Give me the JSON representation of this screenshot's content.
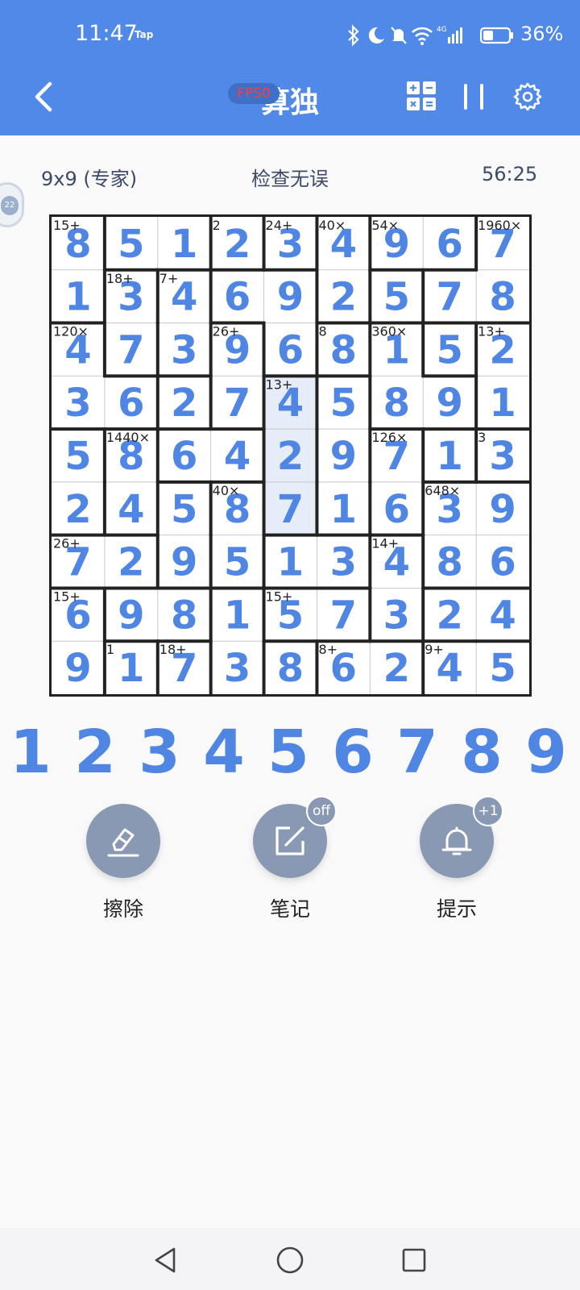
{
  "status_bar": {
    "time": "11:47",
    "tap_label": "Tap",
    "battery_pct": "36%"
  },
  "header": {
    "title": "算独",
    "fps": "FPS0"
  },
  "info": {
    "size_label": "9x9 (专家)",
    "status": "检查无误",
    "timer": "56:25",
    "bubble_label": "22"
  },
  "grid": {
    "values": [
      [
        8,
        5,
        1,
        2,
        3,
        4,
        9,
        6,
        7
      ],
      [
        1,
        3,
        4,
        6,
        9,
        2,
        5,
        7,
        8
      ],
      [
        4,
        7,
        3,
        9,
        6,
        8,
        1,
        5,
        2
      ],
      [
        3,
        6,
        2,
        7,
        4,
        5,
        8,
        9,
        1
      ],
      [
        5,
        8,
        6,
        4,
        2,
        9,
        7,
        1,
        3
      ],
      [
        2,
        4,
        5,
        8,
        7,
        1,
        6,
        3,
        9
      ],
      [
        7,
        2,
        9,
        5,
        1,
        3,
        4,
        8,
        6
      ],
      [
        6,
        9,
        8,
        1,
        5,
        7,
        3,
        2,
        4
      ],
      [
        9,
        1,
        7,
        3,
        8,
        6,
        2,
        4,
        5
      ]
    ],
    "cages": [
      {
        "clue": "15+",
        "cells": [
          [
            0,
            0
          ],
          [
            1,
            0
          ]
        ]
      },
      {
        "clue": "",
        "cells": [
          [
            0,
            1
          ],
          [
            0,
            2
          ]
        ]
      },
      {
        "clue": "2",
        "cells": [
          [
            0,
            3
          ]
        ]
      },
      {
        "clue": "24+",
        "cells": [
          [
            0,
            4
          ]
        ]
      },
      {
        "clue": "40×",
        "cells": [
          [
            0,
            5
          ],
          [
            1,
            5
          ]
        ]
      },
      {
        "clue": "54×",
        "cells": [
          [
            0,
            6
          ],
          [
            0,
            7
          ]
        ]
      },
      {
        "clue": "1960×",
        "cells": [
          [
            0,
            8
          ],
          [
            1,
            8
          ],
          [
            1,
            7
          ]
        ]
      },
      {
        "clue": "18+",
        "cells": [
          [
            1,
            1
          ],
          [
            2,
            1
          ]
        ]
      },
      {
        "clue": "7+",
        "cells": [
          [
            1,
            2
          ],
          [
            2,
            2
          ]
        ]
      },
      {
        "clue": "",
        "cells": [
          [
            1,
            3
          ],
          [
            1,
            4
          ],
          [
            2,
            4
          ],
          [
            1,
            6
          ]
        ]
      },
      {
        "clue": "120×",
        "cells": [
          [
            2,
            0
          ],
          [
            3,
            0
          ],
          [
            3,
            1
          ]
        ]
      },
      {
        "clue": "26+",
        "cells": [
          [
            2,
            3
          ],
          [
            3,
            3
          ]
        ]
      },
      {
        "clue": "8",
        "cells": [
          [
            2,
            5
          ]
        ]
      },
      {
        "clue": "360×",
        "cells": [
          [
            2,
            6
          ],
          [
            3,
            6
          ],
          [
            3,
            7
          ]
        ]
      },
      {
        "clue": "13+",
        "cells": [
          [
            2,
            8
          ],
          [
            3,
            8
          ]
        ]
      },
      {
        "clue": "",
        "cells": [
          [
            3,
            2
          ],
          [
            2,
            7
          ]
        ]
      },
      {
        "clue": "13+",
        "cells": [
          [
            3,
            4
          ],
          [
            4,
            4
          ],
          [
            5,
            4
          ]
        ]
      },
      {
        "clue": "",
        "cells": [
          [
            3,
            5
          ],
          [
            4,
            5
          ],
          [
            5,
            5
          ]
        ]
      },
      {
        "clue": "",
        "cells": [
          [
            4,
            0
          ],
          [
            5,
            0
          ]
        ]
      },
      {
        "clue": "1440×",
        "cells": [
          [
            4,
            1
          ],
          [
            5,
            1
          ]
        ]
      },
      {
        "clue": "",
        "cells": [
          [
            4,
            2
          ],
          [
            4,
            3
          ]
        ]
      },
      {
        "clue": "126×",
        "cells": [
          [
            4,
            6
          ],
          [
            5,
            6
          ]
        ]
      },
      {
        "clue": "",
        "cells": [
          [
            4,
            7
          ]
        ]
      },
      {
        "clue": "3",
        "cells": [
          [
            4,
            8
          ]
        ]
      },
      {
        "clue": "",
        "cells": [
          [
            5,
            2
          ],
          [
            6,
            2
          ]
        ]
      },
      {
        "clue": "40×",
        "cells": [
          [
            5,
            3
          ],
          [
            6,
            3
          ]
        ]
      },
      {
        "clue": "648×",
        "cells": [
          [
            5,
            7
          ],
          [
            5,
            8
          ],
          [
            6,
            7
          ],
          [
            6,
            8
          ]
        ]
      },
      {
        "clue": "26+",
        "cells": [
          [
            6,
            0
          ],
          [
            6,
            1
          ]
        ]
      },
      {
        "clue": "",
        "cells": [
          [
            6,
            4
          ],
          [
            6,
            5
          ]
        ]
      },
      {
        "clue": "14+",
        "cells": [
          [
            6,
            6
          ],
          [
            7,
            6
          ]
        ]
      },
      {
        "clue": "15+",
        "cells": [
          [
            7,
            0
          ],
          [
            8,
            0
          ]
        ]
      },
      {
        "clue": "",
        "cells": [
          [
            7,
            1
          ],
          [
            7,
            2
          ]
        ]
      },
      {
        "clue": "",
        "cells": [
          [
            7,
            3
          ],
          [
            8,
            3
          ]
        ]
      },
      {
        "clue": "15+",
        "cells": [
          [
            7,
            4
          ],
          [
            7,
            5
          ]
        ]
      },
      {
        "clue": "",
        "cells": [
          [
            7,
            7
          ],
          [
            7,
            8
          ]
        ]
      },
      {
        "clue": "1",
        "cells": [
          [
            8,
            1
          ]
        ]
      },
      {
        "clue": "18+",
        "cells": [
          [
            8,
            2
          ]
        ]
      },
      {
        "clue": "",
        "cells": [
          [
            8,
            4
          ]
        ]
      },
      {
        "clue": "8+",
        "cells": [
          [
            8,
            5
          ],
          [
            8,
            6
          ]
        ]
      },
      {
        "clue": "9+",
        "cells": [
          [
            8,
            7
          ],
          [
            8,
            8
          ]
        ]
      }
    ],
    "highlight_cells": [
      [
        3,
        4
      ],
      [
        4,
        4
      ],
      [
        5,
        4
      ]
    ],
    "highlight_color": "#e6edf8",
    "digit_color": "#4f85e3"
  },
  "numpad": [
    "1",
    "2",
    "3",
    "4",
    "5",
    "6",
    "7",
    "8",
    "9"
  ],
  "tools": {
    "erase": {
      "label": "擦除"
    },
    "notes": {
      "label": "笔记",
      "badge": "off"
    },
    "hint": {
      "label": "提示",
      "badge": "+1"
    }
  },
  "colors": {
    "header_bg": "#5089e8",
    "tool_bg": "#8998b3",
    "accent": "#4f85e3"
  }
}
